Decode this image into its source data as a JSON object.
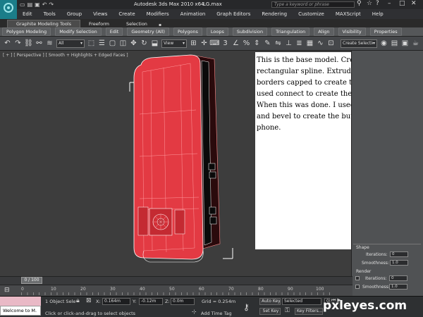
{
  "app": {
    "title": "Autodesk 3ds Max  2010 x64",
    "file": "LG.max",
    "search_placeholder": "Type a keyword or phrase",
    "logo_icon": "3dsmax-logo-icon"
  },
  "menu": [
    "Edit",
    "Tools",
    "Group",
    "Views",
    "Create",
    "Modifiers",
    "Animation",
    "Graph Editors",
    "Rendering",
    "Customize",
    "MAXScript",
    "Help"
  ],
  "ribbon": {
    "tabs": [
      "Graphite Modeling Tools",
      "Freeform",
      "Selection"
    ],
    "active_tab": "Graphite Modeling Tools",
    "subtabs": [
      "Polygon Modeling",
      "Modify Selection",
      "Edit",
      "Geometry (All)",
      "Polygons",
      "Loops",
      "Subdivision",
      "Triangulation",
      "Align",
      "Visibility",
      "Properties"
    ]
  },
  "toolbar": {
    "filter": "All",
    "view": "View",
    "snap_number": "3",
    "selection_set_placeholder": "Create Selection Se"
  },
  "viewport": {
    "label": "[ + ] [ Perspective ] [ Smooth + Highlights + Edged Faces ]",
    "object_color": "#e0303a",
    "wire_color": "#ff8a8a"
  },
  "annotation": {
    "text": "This is the base model. Created from a rectangular spline. Extruded then the borders capped to create the box. I then used connect to create the polys i needed. When this was done. I used extrude/chamfer and bevel to create the buttons for the phone."
  },
  "command_panel": {
    "shape_label": "Shape",
    "iterations_label": "Iterations:",
    "iterations_value": "0",
    "smoothness_label": "Smoothness:",
    "smoothness_value": "1.0",
    "render_label": "Render",
    "render_iterations_value": "0",
    "render_smoothness_value": "1.0"
  },
  "timeline": {
    "frame": "0 / 100",
    "ticks": [
      "0",
      "10",
      "20",
      "30",
      "40",
      "50",
      "60",
      "70",
      "80",
      "90",
      "100"
    ]
  },
  "status": {
    "selected": "1 Object Sele",
    "prompt": "Click or click-and-drag to select objects",
    "x_label": "X:",
    "x_value": "0.164m",
    "y_label": "Y:",
    "y_value": "-0.12m",
    "z_label": "Z:",
    "z_value": "0.0m",
    "grid": "Grid = 0.254m",
    "add_time_tag": "Add Time Tag",
    "auto_key": "Auto Key",
    "key_mode": "Selected",
    "set_key": "Set Key",
    "key_filters": "Key Filters...",
    "frame_value": "0",
    "maxscript": "Welcome to M."
  },
  "watermark": "pxleyes.com"
}
